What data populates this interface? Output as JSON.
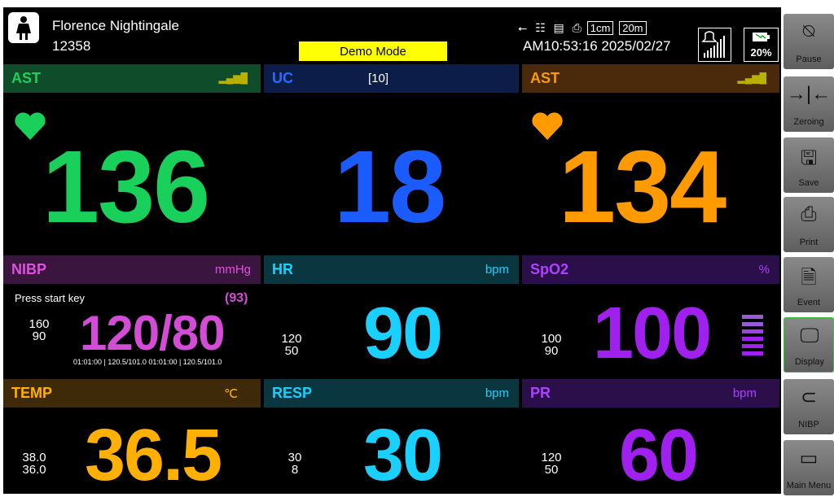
{
  "header": {
    "patient_name": "Florence Nightingale",
    "patient_id": "12358",
    "demo_mode": "Demo Mode",
    "scale_1": "1cm",
    "scale_2": "20m",
    "datetime": "AM10:53:16 2025/02/27",
    "battery": "20%",
    "icons": [
      "usb-icon",
      "network-icon",
      "storage-icon",
      "printer-icon",
      "bell-icon",
      "signal-bars-icon",
      "battery-icon"
    ]
  },
  "panels": {
    "ast1": {
      "label": "AST",
      "value": "136",
      "color": "#18d05a"
    },
    "uc": {
      "label": "UC",
      "sub": "[10]",
      "value": "18",
      "color": "#1a5cff"
    },
    "ast2": {
      "label": "AST",
      "value": "134",
      "color": "#ff9a00"
    },
    "nibp": {
      "label": "NIBP",
      "unit": "mmHg",
      "status": "Press start key",
      "mean": "(93)",
      "lim_hi": "160",
      "lim_lo": "90",
      "value": "120/80",
      "history": "01:01:00 | 120.5/101.0   01:01:00 | 120.5/101.0",
      "color": "#d24cd6"
    },
    "hr": {
      "label": "HR",
      "unit": "bpm",
      "lim_hi": "120",
      "lim_lo": "50",
      "value": "90",
      "color": "#1ad0ff"
    },
    "spo2": {
      "label": "SpO2",
      "unit": "%",
      "lim_hi": "100",
      "lim_lo": "90",
      "value": "100",
      "color": "#a020f0"
    },
    "temp": {
      "label": "TEMP",
      "unit": "℃",
      "lim_hi": "38.0",
      "lim_lo": "36.0",
      "value": "36.5",
      "color": "#ffb000"
    },
    "resp": {
      "label": "RESP",
      "unit": "bpm",
      "lim_hi": "30",
      "lim_lo": "8",
      "value": "30",
      "color": "#1ad0ff"
    },
    "pr": {
      "label": "PR",
      "unit": "bpm",
      "lim_hi": "120",
      "lim_lo": "50",
      "value": "60",
      "color": "#a020f0"
    }
  },
  "sidebar": {
    "buttons": [
      {
        "label": "Pause",
        "icon": "alarm-pause-icon"
      },
      {
        "label": "Zeroing",
        "icon": "zeroing-icon"
      },
      {
        "label": "Save",
        "icon": "save-icon"
      },
      {
        "label": "Print",
        "icon": "print-icon"
      },
      {
        "label": "Event",
        "icon": "event-icon"
      },
      {
        "label": "Display",
        "icon": "display-icon"
      },
      {
        "label": "NIBP",
        "icon": "nibp-cuff-icon"
      },
      {
        "label": "Main Menu",
        "icon": "main-menu-icon"
      }
    ]
  }
}
